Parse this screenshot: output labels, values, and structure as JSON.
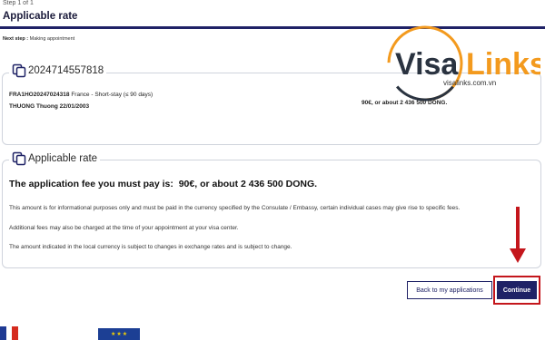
{
  "header": {
    "step": "Step 1 of 1",
    "title": "Applicable rate",
    "next_step_label": "Next step :",
    "next_step_value": "Making appointment"
  },
  "application_card": {
    "id": "2024714557818",
    "code": "FRA1HO20247024318",
    "visa_type": "France - Short-stay (≤ 90 days)",
    "applicant": "THUONG Thuong 22/01/2003",
    "fee": "90€, or about 2 436 500 DONG."
  },
  "rate_card": {
    "title": "Applicable rate",
    "fee_prefix": "The application fee you must pay is:",
    "fee_amount": "90€, or about 2 436 500 DONG.",
    "info_1": "This amount is for informational purposes only and must be paid in the currency specified by the Consulate / Embassy, certain individual cases may give rise to specific fees.",
    "info_2": "Additional fees may also be charged at the time of your appointment at your visa center.",
    "info_3": "The amount indicated in the local currency is subject to changes in exchange rates and is subject to change."
  },
  "actions": {
    "back_label": "Back to my applications",
    "continue_label": "Continue"
  },
  "watermark": {
    "brand_visa": "Visa",
    "brand_links": "Links",
    "site": "visalinks.com.vn"
  },
  "colors": {
    "primary": "#1f2266",
    "highlight": "#c4161c",
    "logo_orange": "#f39a1e",
    "logo_dark": "#2a3340"
  },
  "icons": {
    "card_header": "copy-icon",
    "annotation": "down-arrow-icon"
  }
}
